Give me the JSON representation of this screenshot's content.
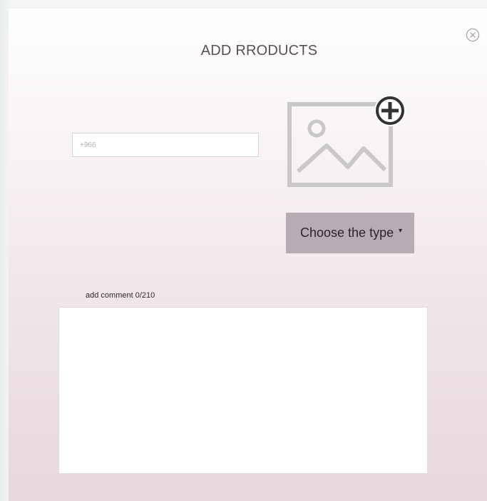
{
  "modal": {
    "title": "ADD RRODUCTS",
    "close_icon": "close-circle-icon"
  },
  "phone": {
    "placeholder": "+966",
    "value": ""
  },
  "image_upload": {
    "icon": "image-placeholder-icon",
    "add_icon": "plus-circle-icon"
  },
  "type_select": {
    "selected": "Choose the type",
    "caret": "▾"
  },
  "comment": {
    "label": "add comment 0/210",
    "value": ""
  },
  "colors": {
    "select_bg": "#b5adb3",
    "title": "#5c4e52",
    "image_icon": "#c8c8c8"
  }
}
